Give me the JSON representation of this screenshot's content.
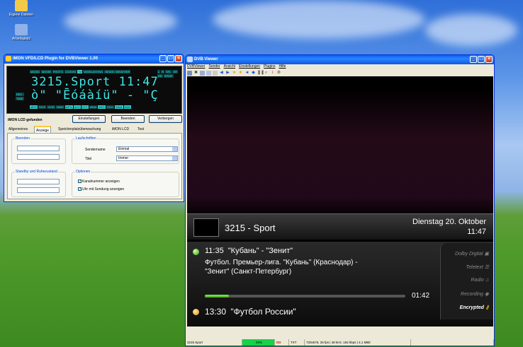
{
  "desktop": {
    "icons": [
      {
        "label": "Eigene Dateien"
      },
      {
        "label": "Arbeitsplatz"
      }
    ]
  },
  "imon": {
    "title": "iMON VFD/LCD Plugin for DVBViewer 1.00",
    "lcd": {
      "top_tags": [
        "MUSIC",
        "MOVIE",
        "PHOTO",
        "CD/DVD",
        "TV",
        "WEBCASTING",
        "NEWS / WEATHER"
      ],
      "top_active": "TV",
      "right_tags": [
        "L",
        "R",
        "SFL",
        "SR",
        "RR",
        "SPDIF"
      ],
      "line1": "3215.Sport 11:47",
      "line2": "ò\" \"Ēóáàíü\" - \"Ç",
      "left_tags": [
        "REC",
        "TIME"
      ],
      "bottom_tags": [
        "MPG",
        "DIVX",
        "XVID",
        "WMV",
        "MPG",
        "AC3",
        "DTS",
        "WMA",
        "MP3",
        "OGG",
        "WMA",
        "WAV"
      ],
      "bottom_active": [
        "MPG",
        "AC3",
        "DTS",
        "MP3",
        "WMA",
        "WAV"
      ]
    },
    "status": "iMON LCD gefunden",
    "buttons": {
      "settings": "Einstellungen",
      "quit": "Beenden",
      "hide": "Verbergen"
    },
    "tabs": [
      "Allgemeines",
      "Anzeige",
      "Speicherplatzüberwachung",
      "iMON LCD",
      "Test"
    ],
    "active_tab": "Anzeige",
    "groups": {
      "quit": "Beenden",
      "standby": "Standby und Ruhezustand",
      "ticker": "Laufschriften",
      "options": "Optionen"
    },
    "fields": {
      "sender_label": "Sendername",
      "sender_value": "Einmal",
      "title_label": "Titel",
      "title_value": "Immer"
    },
    "options": [
      "Kanalnummer anzeigen",
      "Uhr mit Sendung anzeigen"
    ]
  },
  "dvb": {
    "title": "DVB Viewer",
    "menu": [
      "DVBViewer",
      "Sender",
      "Ansicht",
      "Einstellungen",
      "Plugins",
      "Hilfe"
    ],
    "osd": {
      "channel": "3215 - Sport",
      "date": "Dienstag 20. Oktober",
      "time": "11:47",
      "now": {
        "time": "11:35",
        "title": "\"Кубань\" - \"Зенит\"",
        "desc1": "Футбол. Премьер-лига. \"Кубань\" (Краснодар) -",
        "desc2": "\"Зенит\" (Санкт-Петербург)",
        "remaining": "01:42",
        "progress": 0.12
      },
      "next": {
        "time": "13:30",
        "title": "\"Футбол России\""
      },
      "side": [
        {
          "label": "Dolby Digital",
          "icon": "dd-icon",
          "on": false
        },
        {
          "label": "Teletext",
          "icon": "teletext-icon",
          "on": false
        },
        {
          "label": "Radio",
          "icon": "music-icon",
          "on": false
        },
        {
          "label": "Recording",
          "icon": "record-icon",
          "on": false
        },
        {
          "label": "Encrypted",
          "icon": "key-icon",
          "on": true
        }
      ]
    },
    "status": {
      "channel": "3215 Sport",
      "signal": "93%",
      "info": "720x576, 25 fps | 48 kHz, 192 kbps | 4,1 MBit"
    }
  }
}
